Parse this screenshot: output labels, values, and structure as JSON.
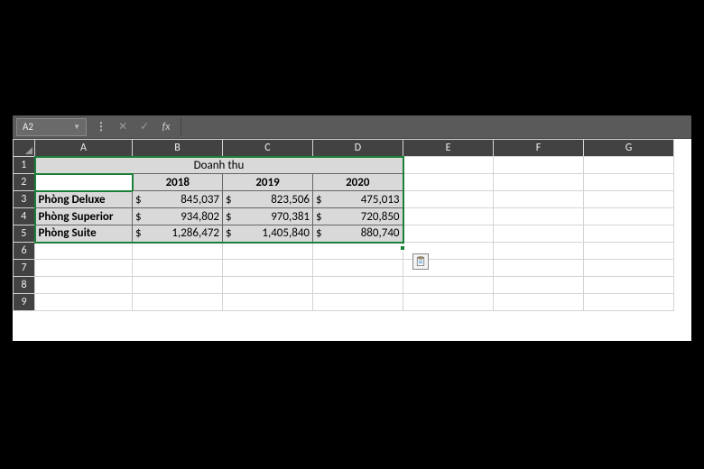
{
  "name_box": "A2",
  "formula_value": "",
  "columns": [
    "A",
    "B",
    "C",
    "D",
    "E",
    "F",
    "G"
  ],
  "rows": [
    "1",
    "2",
    "3",
    "4",
    "5",
    "6",
    "7",
    "8",
    "9"
  ],
  "title": "Doanh thu",
  "years": [
    "2018",
    "2019",
    "2020"
  ],
  "currency": "$",
  "data_rows": [
    {
      "label": "Phòng Deluxe",
      "values": [
        "845,037",
        "823,506",
        "475,013"
      ]
    },
    {
      "label": "Phòng Superior",
      "values": [
        "934,802",
        "970,381",
        "720,850"
      ]
    },
    {
      "label": "Phòng Suite",
      "values": [
        "1,286,472",
        "1,405,840",
        "880,740"
      ]
    }
  ],
  "fx_label": "fx",
  "cancel_glyph": "✕",
  "confirm_glyph": "✓"
}
